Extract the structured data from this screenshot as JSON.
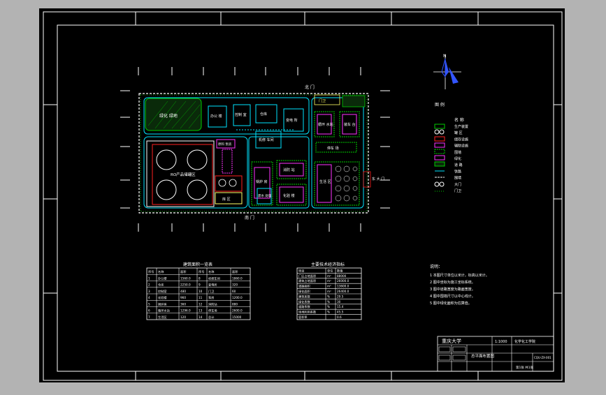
{
  "colors": {
    "app_frame": "#b3b3b3",
    "canvas": "#000000",
    "line": "#ffffff",
    "road": "#00e5ff",
    "green_belt": "#00cc00",
    "red": "#ff2020",
    "magenta": "#ff33ff",
    "yellow": "#ffff66"
  },
  "plan": {
    "gate_north": "北 门",
    "gate_south": "南 门",
    "gate_east": "东 大 门",
    "green_area": "绿化 绿地",
    "tank_area": "RO产品储罐区",
    "tank_count": 4,
    "blocks": {
      "b1": "办公 楼",
      "b2": "控制 室",
      "b3": "仓库",
      "b4": "变电 所",
      "b5": "机修 车间",
      "b6": "门卫",
      "b7": "循环 水站",
      "b8": "装车 台",
      "b9": "原料 泵房",
      "b10": "锅炉 房",
      "b11": "消防 站",
      "b12": "化验 楼",
      "b13": "废水 处理",
      "b14": "停车 场",
      "b15": "生活 区",
      "b16": "泵 房",
      "b17": "库 区"
    }
  },
  "legend": {
    "title": "图 例",
    "header_name": "名 称",
    "items": [
      "生产装置",
      "罐 区",
      "储存设施",
      "辅助设施",
      "围墙",
      "绿化",
      "道 路",
      "铁路",
      "围墙",
      "大门",
      "门卫"
    ]
  },
  "table1": {
    "title": "建筑面积一览表",
    "headers": [
      "序号",
      "名称",
      "面积",
      "序号",
      "名称",
      "面积"
    ],
    "rows": [
      [
        "1",
        "办公楼",
        "1560.0",
        "8",
        "机修车间",
        "1860.0"
      ],
      [
        "2",
        "仓库",
        "2250.0",
        "9",
        "变电所",
        "320"
      ],
      [
        "3",
        "控制室",
        "480",
        "10",
        "门卫",
        "60"
      ],
      [
        "4",
        "化验楼",
        "960",
        "11",
        "泵房",
        "1200.0"
      ],
      [
        "5",
        "锅炉房",
        "360",
        "12",
        "消防站",
        "880"
      ],
      [
        "6",
        "循环水站",
        "1296.0",
        "13",
        "停车场",
        "2600.0"
      ],
      [
        "7",
        "生活区",
        "120",
        "14",
        "总计",
        "15000"
      ]
    ]
  },
  "table2": {
    "title": "主要技术经济指标",
    "headers": [
      "项目",
      "单位",
      "数值"
    ],
    "rows": [
      [
        "厂区占地面积",
        "m²",
        "88000"
      ],
      [
        "建筑占地面积",
        "m²",
        "26000.0"
      ],
      [
        "道路面积",
        "m²",
        "13600.0"
      ],
      [
        "绿化面积",
        "m²",
        "26400.0"
      ],
      [
        "建筑系数",
        "%",
        "29.5"
      ],
      [
        "绿化系数",
        "%",
        "30"
      ],
      [
        "道路系数",
        "%",
        "15.4"
      ],
      [
        "场地利用系数",
        "%",
        "45.5"
      ],
      [
        "容积率",
        "",
        "0.6"
      ]
    ]
  },
  "notes": {
    "title": "说明：",
    "lines": [
      "1  本图尺寸单位以米计，标高以米计。",
      "2  图中坐标为施工坐标系统。",
      "3  图中道路宽度为路面宽度。",
      "4  图中围墙尺寸以中心线计。",
      "5  图中绿化面积为估算值。"
    ]
  },
  "title_block": {
    "school": "重庆大学",
    "org": "化学化工学院",
    "drawing": "总平面布置图",
    "scale": "1:1000",
    "drawing_no": "CQU-ZX-001",
    "sheet": "第1张 共1张"
  },
  "compass_label": "N"
}
